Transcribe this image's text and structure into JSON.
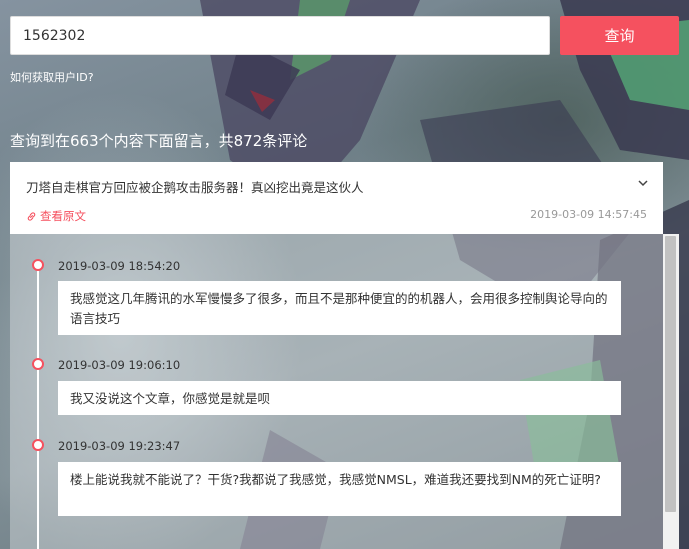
{
  "search": {
    "value": "1562302",
    "button_label": "查询"
  },
  "help_link": "如何获取用户ID?",
  "summary": "查询到在663个内容下面留言，共872条评论",
  "article": {
    "title": "刀塔自走棋官方回应被企鹅攻击服务器！真凶挖出竟是这伙人",
    "view_label": "查看原文",
    "date": "2019-03-09 14:57:45"
  },
  "comments": [
    {
      "time": "2019-03-09 18:54:20",
      "text": "我感觉这几年腾讯的水军慢慢多了很多，而且不是那种便宜的的机器人，会用很多控制舆论导向的语言技巧"
    },
    {
      "time": "2019-03-09 19:06:10",
      "text": "我又没说这个文章，你感觉是就是呗"
    },
    {
      "time": "2019-03-09 19:23:47",
      "text": "楼上能说我就不能说了？干货?我都说了我感觉，我感觉NMSL，难道我还要找到NM的死亡证明?"
    }
  ],
  "colors": {
    "accent": "#f5515f"
  }
}
